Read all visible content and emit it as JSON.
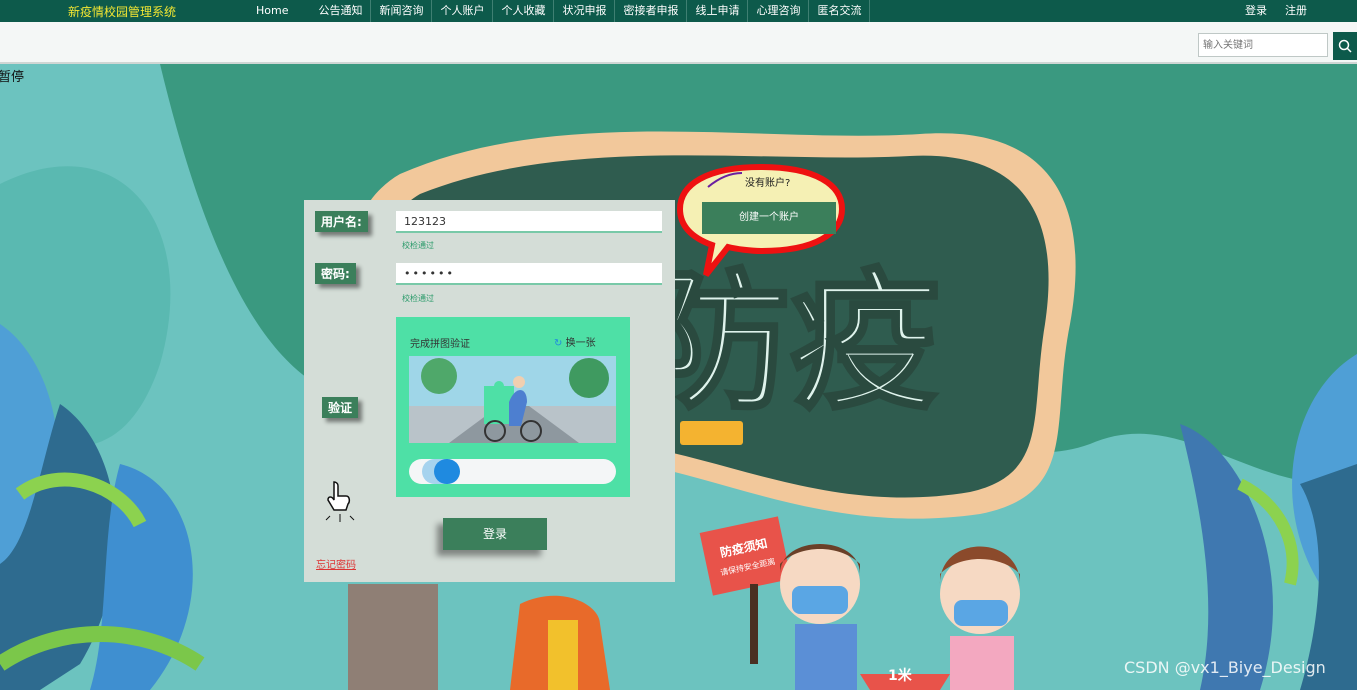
{
  "app": {
    "title": "新疫情校园管理系统"
  },
  "nav": {
    "items": [
      "Home",
      "公告通知",
      "新闻咨询",
      "个人账户",
      "个人收藏",
      "状况申报",
      "密接者申报",
      "线上申请",
      "心理咨询",
      "匿名交流"
    ]
  },
  "auth": {
    "login": "登录",
    "register": "注册"
  },
  "search": {
    "placeholder": "输入关键词"
  },
  "page": {
    "stop_text": "暂停"
  },
  "banner": {
    "title": "防疫",
    "sign_text": "防疫须知",
    "sign_sub": "请保持安全距离",
    "ground_text": "1米"
  },
  "form": {
    "username_label": "用户名:",
    "username_value": "123123",
    "username_hint": "校检通过",
    "password_label": "密码:",
    "password_value": "••••••",
    "password_hint": "校检通过",
    "captcha_label": "验证",
    "captcha_title": "完成拼图验证",
    "captcha_refresh": "换一张",
    "slider_progress": 0.14,
    "login_button": "登录",
    "forgot_link": "忘记密码"
  },
  "register_bubble": {
    "question": "没有账户?",
    "create_button": "创建一个账户"
  },
  "watermark": "CSDN @vx1_Biye_Design",
  "colors": {
    "nav_bg": "#0d5a4b",
    "brand": "#f2e633",
    "accent": "#3b7f5b",
    "captcha_bg": "#4ee0a6",
    "knob": "#1f8ae0"
  }
}
